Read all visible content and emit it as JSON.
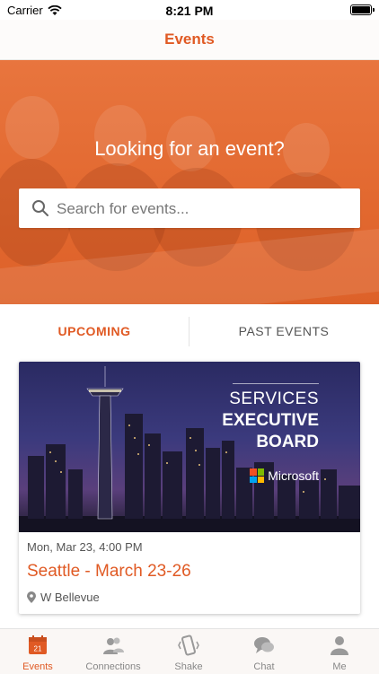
{
  "status": {
    "carrier": "Carrier",
    "time": "8:21 PM",
    "battery_level": 0.9
  },
  "navbar": {
    "title": "Events"
  },
  "hero": {
    "heading": "Looking for an event?"
  },
  "search": {
    "placeholder": "Search for events..."
  },
  "tabs": {
    "upcoming": "UPCOMING",
    "past": "PAST EVENTS"
  },
  "event_card": {
    "banner": {
      "line1": "SERVICES",
      "line2": "EXECUTIVE",
      "line3": "BOARD",
      "brand": "Microsoft"
    },
    "date": "Mon, Mar 23, 4:00 PM",
    "name": "Seattle - March 23-26",
    "location": "W Bellevue"
  },
  "tabbar": {
    "items": [
      {
        "label": "Events",
        "icon": "calendar-icon",
        "badge": "21"
      },
      {
        "label": "Connections",
        "icon": "people-icon"
      },
      {
        "label": "Shake",
        "icon": "phone-shake-icon"
      },
      {
        "label": "Chat",
        "icon": "chat-bubbles-icon"
      },
      {
        "label": "Me",
        "icon": "person-icon"
      }
    ]
  },
  "colors": {
    "accent": "#e05a24",
    "hero": "#e2682f"
  }
}
